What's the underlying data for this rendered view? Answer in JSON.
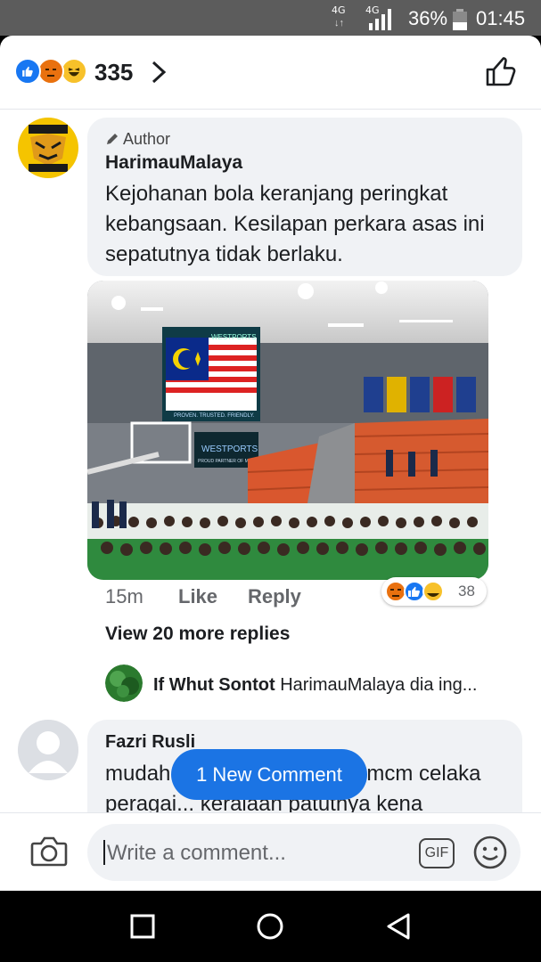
{
  "status_bar": {
    "network_1": "4G",
    "network_2": "4G",
    "battery": "36%",
    "time": "01:45"
  },
  "header": {
    "reaction_icons": [
      "like-icon",
      "angry-icon",
      "haha-icon"
    ],
    "reaction_count": "335"
  },
  "post_comment": {
    "author_tag": "Author",
    "author_name": "HarimauMalaya",
    "text": "Kejohanan bola keranjang peringkat kebangsaan. Kesilapan perkara asas ini sepatutnya tidak berlaku.",
    "time": "15m",
    "like_label": "Like",
    "reply_label": "Reply",
    "reaction_count": "38",
    "photo": {
      "banner_brand": "WESTPORTS",
      "banner_tagline": "PROVEN. TRUSTED. FRIENDLY.",
      "board_brand": "WESTPORTS",
      "board_sub": "PROUD PARTNER OF MABA"
    }
  },
  "replies": {
    "view_more": "View 20 more replies",
    "preview_name": "If Whut Sontot",
    "preview_text": "HarimauMalaya dia ing..."
  },
  "next_comment": {
    "name": "Fazri Rusli",
    "text_line1_start": "mudah",
    "text_line1_end": "mcm celaka",
    "text_line2": "peragai... keraiaan patutnya kena"
  },
  "new_comment_pill": "1 New Comment",
  "composer": {
    "placeholder": "Write a comment...",
    "gif_label": "GIF"
  },
  "colors": {
    "accent": "#1b74e4",
    "bubble": "#f0f2f5",
    "status_bar": "#5c5c5c"
  }
}
